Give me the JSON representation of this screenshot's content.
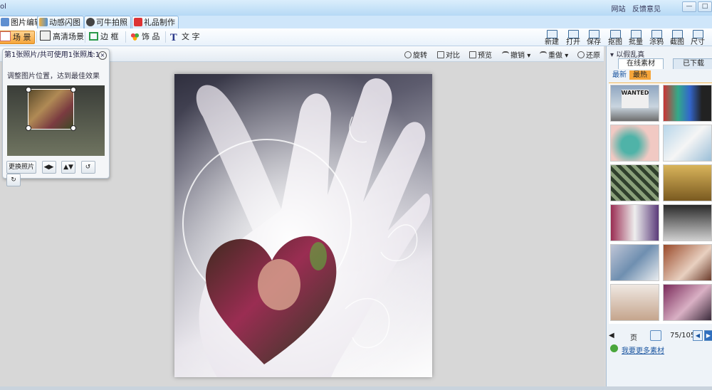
{
  "window": {
    "title_fragment": "ol",
    "links": [
      "网站",
      "反馈意见"
    ],
    "buttons": [
      "—",
      "□"
    ]
  },
  "main_tabs": [
    {
      "label": "图片编辑",
      "icon": "image-edit-icon",
      "active": true
    },
    {
      "label": "动感闪图",
      "icon": "flash-gif-icon",
      "active": false
    },
    {
      "label": "可牛拍照",
      "icon": "camera-icon",
      "active": false
    },
    {
      "label": "礼品制作",
      "icon": "gift-icon",
      "active": false
    }
  ],
  "tools": [
    {
      "label": "场 景",
      "icon": "scene-icon",
      "active": true
    },
    {
      "label": "高清场景",
      "icon": "hd-scene-icon",
      "active": false
    },
    {
      "label": "边 框",
      "icon": "frame-icon",
      "active": false
    },
    {
      "label": "饰 品",
      "icon": "decoration-icon",
      "active": false
    },
    {
      "label": "文 字",
      "icon": "text-icon",
      "active": false
    }
  ],
  "right_tools": [
    "新建",
    "打开",
    "保存",
    "抠图",
    "批量",
    "涂鸦",
    "截图",
    "尺寸"
  ],
  "canvas_toolbar": [
    "旋转",
    "对比",
    "预览",
    "撤销",
    "重做",
    "还原"
  ],
  "photo_panel": {
    "header": "第1张照片/共可使用1张照片",
    "ratio": "1:1",
    "hint": "调整图片位置，达到最佳效果",
    "replace_label": "更换照片",
    "controls": [
      "flip-horizontal-icon",
      "flip-vertical-icon",
      "rotate-left-icon",
      "rotate-right-icon"
    ]
  },
  "materials": {
    "title": "以假乱真",
    "tabs": [
      "在线素材",
      "已下载"
    ],
    "subtabs": [
      "最新",
      "最热"
    ],
    "active_subtab": "最热",
    "thumbs": [
      {
        "caption": "WANTED"
      },
      {
        "caption": ""
      },
      {
        "caption": ""
      },
      {
        "caption": ""
      },
      {
        "caption": ""
      },
      {
        "caption": ""
      },
      {
        "caption": ""
      },
      {
        "caption": ""
      },
      {
        "caption": ""
      },
      {
        "caption": ""
      },
      {
        "caption": ""
      },
      {
        "caption": ""
      }
    ],
    "pager": {
      "prev_label": "页",
      "page_status": "75/105",
      "link_text": "我要更多素材"
    }
  },
  "colors": {
    "accent_orange": "#f6a53a",
    "tab_blue": "#cfe6fa",
    "pager_green": "#4aa63c"
  }
}
